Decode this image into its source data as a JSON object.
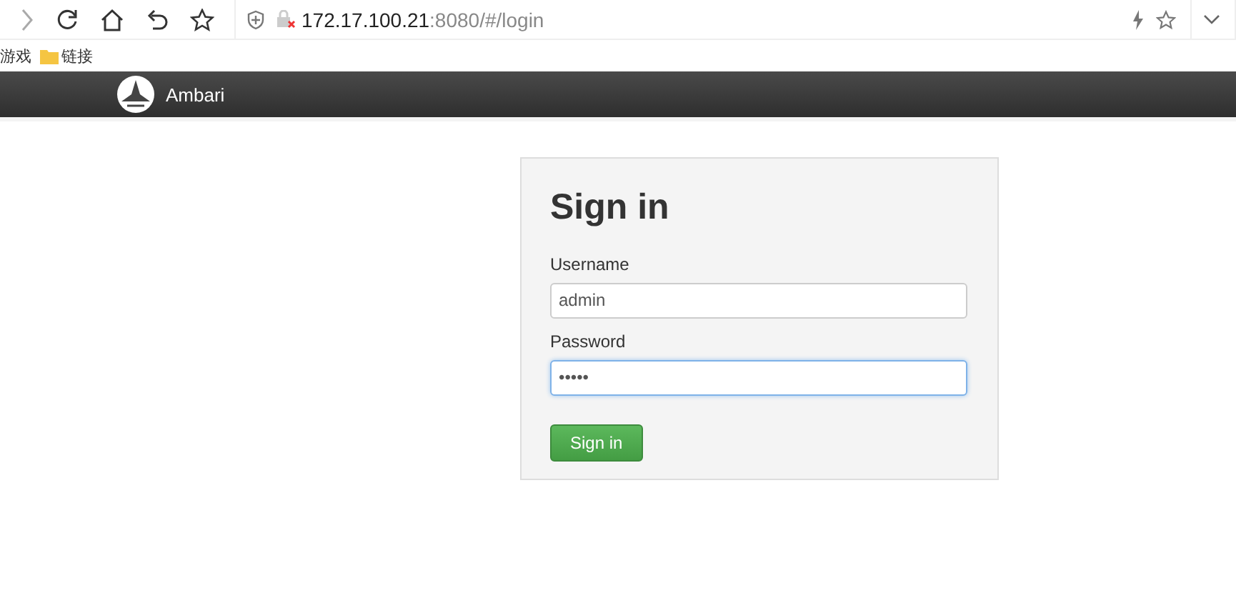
{
  "browser": {
    "url_host": "172.17.100.21",
    "url_path": ":8080/#/login"
  },
  "bookmarks": [
    {
      "kind": "text",
      "label": "游戏"
    },
    {
      "kind": "folder",
      "label": "链接"
    }
  ],
  "header": {
    "brand": "Ambari"
  },
  "form": {
    "title": "Sign in",
    "fields": [
      {
        "label": "Username",
        "value": "admin",
        "focused": false
      },
      {
        "label": "Password",
        "value": "•••••",
        "focused": true
      }
    ],
    "button": "Sign in"
  }
}
